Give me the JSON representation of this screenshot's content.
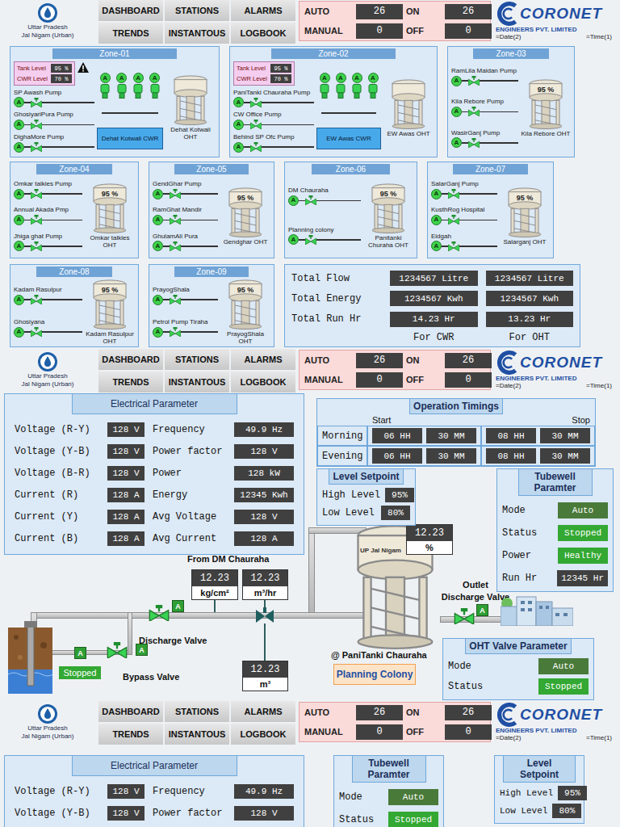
{
  "header": {
    "org": {
      "line1": "Uttar Pradesh",
      "line2": "Jal Nigam (Urban)"
    },
    "nav": [
      {
        "label": "DASHBOARD",
        "selected": false
      },
      {
        "label": "STATIONS",
        "selected": false
      },
      {
        "label": "ALARMS",
        "selected": false
      },
      {
        "label": "TRENDS",
        "selected": false
      },
      {
        "label": "INSTANTOUS",
        "selected": false
      },
      {
        "label": "LOGBOOK",
        "selected": false
      }
    ],
    "counts": [
      {
        "label": "AUTO",
        "value": "26"
      },
      {
        "label": "ON",
        "value": "26"
      },
      {
        "label": "MANUAL",
        "value": "0"
      },
      {
        "label": "OFF",
        "value": "0"
      }
    ],
    "brand": {
      "name": "CORONET",
      "sub": "ENGINEERS PVT. LIMITED",
      "date": "=Date(2)",
      "time": "=Time(1)"
    }
  },
  "dashboard": {
    "zones": [
      {
        "title": "Zone-01",
        "kind": "cwr",
        "alarm": true,
        "tank_level": {
          "label": "Tank Level",
          "value": "95 %"
        },
        "cwr_level": {
          "label": "CWR Level",
          "value": "70 %"
        },
        "pumps": [
          {
            "label": "SP Awash Pump",
            "mode": "A"
          },
          {
            "label": "GhosiyariPura Pump",
            "mode": "A"
          },
          {
            "label": "DighaMore Pump",
            "mode": "A"
          }
        ],
        "cwr": {
          "label": "Dehat Kotwali CWR",
          "motors": [
            "A",
            "A",
            "A",
            "A"
          ]
        },
        "oht": {
          "label": "Dehat Kotwali OHT"
        }
      },
      {
        "title": "Zone-02",
        "kind": "cwr",
        "alarm": false,
        "tank_level": {
          "label": "Tank Level",
          "value": "95 %"
        },
        "cwr_level": {
          "label": "CWR Level",
          "value": "70 %"
        },
        "pumps": [
          {
            "label": "PaniTanki Chauraha Pump",
            "mode": "A"
          },
          {
            "label": "CW Office Pump",
            "mode": "A"
          },
          {
            "label": "Behind SP Ofc Pump",
            "mode": "A"
          }
        ],
        "cwr": {
          "label": "EW Awas CWR",
          "motors": [
            "A",
            "A",
            "A",
            "A"
          ]
        },
        "oht": {
          "label": "EW Awas OHT"
        }
      },
      {
        "title": "Zone-03",
        "kind": "oht",
        "pumps": [
          {
            "label": "RamLila Maidan Pump",
            "mode": "A"
          },
          {
            "label": "Kila Rebore Pump",
            "mode": "A"
          },
          {
            "label": "WasirGanj Pump",
            "mode": "A"
          }
        ],
        "oht": {
          "label": "Kila Rebore OHT",
          "level": "95 %"
        }
      },
      {
        "title": "Zone-04",
        "kind": "oht",
        "pumps": [
          {
            "label": "Omkar talkies Pump",
            "mode": "A"
          },
          {
            "label": "Annual Akada Pmp",
            "mode": "A"
          },
          {
            "label": "Jhiga ghat Pump",
            "mode": "A"
          }
        ],
        "oht": {
          "label": "Omkar talkies OHT",
          "level": "95 %"
        }
      },
      {
        "title": "Zone-05",
        "kind": "oht",
        "pumps": [
          {
            "label": "GendGhar Pump",
            "mode": "A"
          },
          {
            "label": "RamGhat Mandir",
            "mode": "A"
          },
          {
            "label": "GhulamAli Pura",
            "mode": "A"
          }
        ],
        "oht": {
          "label": "Gendghar OHT",
          "level": "95 %"
        }
      },
      {
        "title": "Zone-06",
        "kind": "oht",
        "pumps": [
          {
            "label": "DM Chauraha",
            "mode": "A"
          },
          {
            "label": "Planning colony",
            "mode": "A"
          }
        ],
        "oht": {
          "label": "Panitanki Churaha OHT",
          "level": "95 %"
        }
      },
      {
        "title": "Zone-07",
        "kind": "oht",
        "pumps": [
          {
            "label": "SalarGanj Pump",
            "mode": "A"
          },
          {
            "label": "KusthRog Hospital",
            "mode": "A"
          },
          {
            "label": "Eidgah",
            "mode": "A"
          }
        ],
        "oht": {
          "label": "Salarganj OHT",
          "level": "95 %"
        }
      },
      {
        "title": "Zone-08",
        "kind": "oht",
        "pumps": [
          {
            "label": "Kadam Rasulpur",
            "mode": "A"
          },
          {
            "label": "Ghosiyana",
            "mode": "A"
          }
        ],
        "oht": {
          "label": "Kadam Rasulpur OHT",
          "level": "95 %"
        }
      },
      {
        "title": "Zone-09",
        "kind": "oht",
        "pumps": [
          {
            "label": "PrayogShala",
            "mode": "A"
          },
          {
            "label": "Petrol Pump Tiraha",
            "mode": "A"
          }
        ],
        "oht": {
          "label": "PrayogShala OHT",
          "level": "95 %"
        }
      }
    ],
    "totals": {
      "rows": [
        {
          "label": "Total Flow",
          "cwr": "1234567 Litre",
          "oht": "1234567 Litre"
        },
        {
          "label": "Total Energy",
          "cwr": "1234567 Kwh",
          "oht": "1234567 Kwh"
        },
        {
          "label": "Total Run Hr",
          "cwr": "14.23 Hr",
          "oht": "13.23 Hr"
        }
      ],
      "footer": [
        "For CWR",
        "For OHT"
      ]
    }
  },
  "station": {
    "electrical": {
      "title": "Electrical Parameter",
      "rows": [
        {
          "left_label": "Voltage (R-Y)",
          "left_value": "128 V",
          "right_label": "Frequency",
          "right_value": "49.9 Hz"
        },
        {
          "left_label": "Voltage (Y-B)",
          "left_value": "128 V",
          "right_label": "Power factor",
          "right_value": "128 V"
        },
        {
          "left_label": "Voltage (B-R)",
          "left_value": "128 V",
          "right_label": "Power",
          "right_value": "128 kW"
        },
        {
          "left_label": "Current (R)",
          "left_value": "128 A",
          "right_label": "Energy",
          "right_value": "12345 Kwh"
        },
        {
          "left_label": "Current (Y)",
          "left_value": "128 A",
          "right_label": "Avg Voltage",
          "right_value": "128 V"
        },
        {
          "left_label": "Current (B)",
          "left_value": "128 A",
          "right_label": "Avg Current",
          "right_value": "128 A"
        }
      ]
    },
    "timings": {
      "title": "Operation Timings",
      "start": "Start",
      "stop": "Stop",
      "rows": [
        {
          "label": "Morning",
          "values": [
            "06 HH",
            "30 MM",
            "08 HH",
            "30 MM"
          ]
        },
        {
          "label": "Evening",
          "values": [
            "06 HH",
            "30 MM",
            "08 HH",
            "30 MM"
          ]
        }
      ]
    },
    "setpoint": {
      "title": "Level Setpoint",
      "rows": [
        {
          "label": "High Level",
          "value": "95%"
        },
        {
          "label": "Low Level",
          "value": "80%"
        }
      ]
    },
    "tubewell": {
      "title": "Tubewell Paramter",
      "rows": [
        {
          "label": "Mode",
          "value": "Auto",
          "color": "#4a7a3a"
        },
        {
          "label": "Status",
          "value": "Stopped",
          "color": "#33a833"
        },
        {
          "label": "Power",
          "value": "Healthy",
          "color": "#33a833"
        },
        {
          "label": "Run Hr",
          "value": "12345 Hr",
          "color": "#404040"
        }
      ]
    },
    "diagram": {
      "source": "From DM Chauraha",
      "pressure": {
        "value": "12.23",
        "unit": "kg/cm²"
      },
      "flow_rate": {
        "value": "12.23",
        "unit": "m³/hr"
      },
      "volume": {
        "value": "12.23",
        "unit": "m³"
      },
      "oht_level": {
        "value": "12.23",
        "unit": "%"
      },
      "tank_label": "UP Jal Nigam",
      "location": "@ PaniTanki Chauraha",
      "station_button": "Planning Colony",
      "discharge_valve": {
        "label": "Discharge Valve",
        "mode": "A"
      },
      "bypass_valve": {
        "label": "Bypass Valve",
        "mode": "A"
      },
      "outlet_valve": {
        "label": "Outlet Discharge Valve",
        "mode": "A"
      },
      "pump": {
        "mode": "A",
        "status": "Stopped"
      }
    },
    "oht_valve": {
      "title": "OHT Valve Parameter",
      "rows": [
        {
          "label": "Mode",
          "value": "Auto",
          "color": "#4a7a3a"
        },
        {
          "label": "Status",
          "value": "Stopped",
          "color": "#33a833"
        }
      ]
    }
  },
  "station_preview": {
    "electrical": {
      "title": "Electrical Parameter",
      "rows": [
        {
          "left_label": "Voltage (R-Y)",
          "left_value": "128 V",
          "right_label": "Frequency",
          "right_value": "49.9 Hz"
        },
        {
          "left_label": "Voltage (Y-B)",
          "left_value": "128 V",
          "right_label": "Power factor",
          "right_value": "128 V"
        }
      ]
    },
    "tubewell": {
      "title": "Tubewell Paramter",
      "rows": [
        {
          "label": "Mode",
          "value": "Auto",
          "color": "#4a7a3a"
        },
        {
          "label": "Status",
          "value": "Stopped",
          "color": "#33a833"
        }
      ]
    },
    "setpoint": {
      "title": "Level Setpoint",
      "rows": [
        {
          "label": "High Level",
          "value": "95%"
        },
        {
          "label": "Low Level",
          "value": "80%"
        }
      ]
    }
  }
}
